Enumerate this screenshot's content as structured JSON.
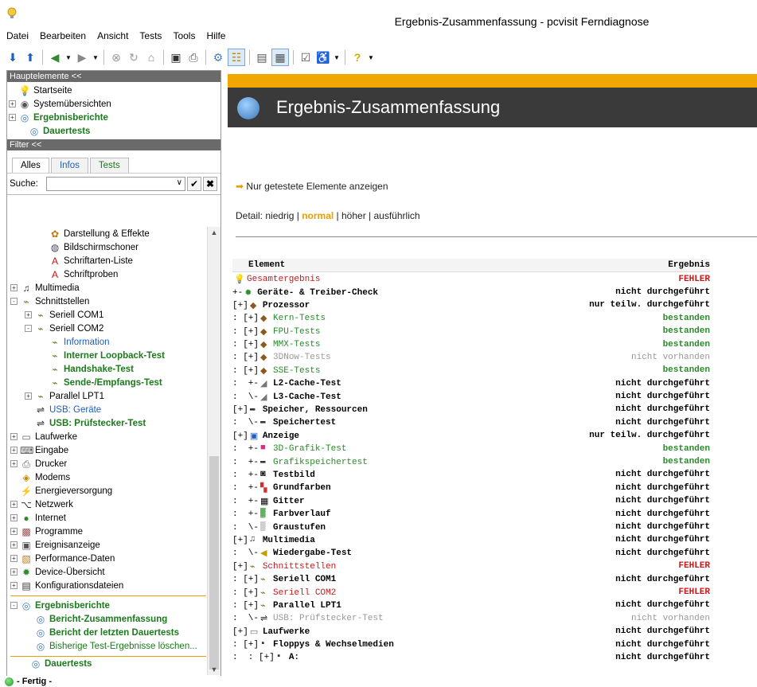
{
  "window": {
    "title": "Ergebnis-Zusammenfassung - pcvisit Ferndiagnose"
  },
  "menu": [
    "Datei",
    "Bearbeiten",
    "Ansicht",
    "Tests",
    "Tools",
    "Hilfe"
  ],
  "toolbar_icons": [
    "arrow-down-icon",
    "arrow-up-icon",
    "back-icon",
    "back-dropdown",
    "forward-icon",
    "forward-dropdown",
    "stop-icon",
    "refresh-icon",
    "home-icon",
    "save-icon",
    "print-icon",
    "gear-icon",
    "tree-view-icon",
    "page-icon",
    "report-icon",
    "properties-icon",
    "accessibility-icon",
    "accessibility-dropdown",
    "help-icon",
    "help-dropdown"
  ],
  "left": {
    "main_header": "Hauptelemente <<",
    "main_items": [
      {
        "label": "Startseite",
        "icon": "bulb-icon",
        "style": "normal"
      },
      {
        "label": "Systemübersichten",
        "icon": "eye-icon",
        "style": "normal",
        "exp": "+"
      },
      {
        "label": "Ergebnisberichte",
        "icon": "report-icon",
        "style": "green-bold",
        "exp": "+"
      },
      {
        "label": "Dauertests",
        "icon": "report-icon",
        "style": "green-bold"
      }
    ],
    "filter_header": "Filter <<",
    "tabs": [
      "Alles",
      "Infos",
      "Tests"
    ],
    "search_label": "Suche:",
    "search_value": "",
    "tree": [
      {
        "label": "Darstellung & Effekte",
        "indent": 2,
        "icon": "display-effects-icon"
      },
      {
        "label": "Bildschirmschoner",
        "indent": 2,
        "icon": "screensaver-icon"
      },
      {
        "label": "Schriftarten-Liste",
        "indent": 2,
        "icon": "font-icon"
      },
      {
        "label": "Schriftproben",
        "indent": 2,
        "icon": "font-icon"
      },
      {
        "label": "Multimedia",
        "indent": 0,
        "icon": "multimedia-icon",
        "exp": "+"
      },
      {
        "label": "Schnittstellen",
        "indent": 0,
        "icon": "plug-icon",
        "exp": "-"
      },
      {
        "label": "Seriell COM1",
        "indent": 1,
        "icon": "plug-icon",
        "exp": "+"
      },
      {
        "label": "Seriell COM2",
        "indent": 1,
        "icon": "plug-icon",
        "exp": "-"
      },
      {
        "label": "Information",
        "indent": 2,
        "icon": "plug-icon",
        "style": "blue"
      },
      {
        "label": "Interner Loopback-Test",
        "indent": 2,
        "icon": "plug-icon",
        "style": "green-bold"
      },
      {
        "label": "Handshake-Test",
        "indent": 2,
        "icon": "plug-icon",
        "style": "green-bold"
      },
      {
        "label": "Sende-/Empfangs-Test",
        "indent": 2,
        "icon": "plug-icon",
        "style": "green-bold"
      },
      {
        "label": "Parallel LPT1",
        "indent": 1,
        "icon": "plug-icon",
        "exp": "+"
      },
      {
        "label": "USB: Geräte",
        "indent": 1,
        "icon": "usb-icon",
        "style": "blue"
      },
      {
        "label": "USB: Prüfstecker-Test",
        "indent": 1,
        "icon": "usb-icon",
        "style": "green-bold"
      },
      {
        "label": "Laufwerke",
        "indent": 0,
        "icon": "drive-icon",
        "exp": "+"
      },
      {
        "label": "Eingabe",
        "indent": 0,
        "icon": "keyboard-icon",
        "exp": "+"
      },
      {
        "label": "Drucker",
        "indent": 0,
        "icon": "printer-icon",
        "exp": "+"
      },
      {
        "label": "Modems",
        "indent": 0,
        "icon": "modem-icon"
      },
      {
        "label": "Energieversorgung",
        "indent": 0,
        "icon": "power-icon"
      },
      {
        "label": "Netzwerk",
        "indent": 0,
        "icon": "network-icon",
        "exp": "+"
      },
      {
        "label": "Internet",
        "indent": 0,
        "icon": "globe-icon",
        "exp": "+"
      },
      {
        "label": "Programme",
        "indent": 0,
        "icon": "programs-icon",
        "exp": "+"
      },
      {
        "label": "Ereignisanzeige",
        "indent": 0,
        "icon": "event-icon",
        "exp": "+"
      },
      {
        "label": "Performance-Daten",
        "indent": 0,
        "icon": "chart-icon",
        "exp": "+"
      },
      {
        "label": "Device-Übersicht",
        "indent": 0,
        "icon": "device-icon",
        "exp": "+"
      },
      {
        "label": "Konfigurationsdateien",
        "indent": 0,
        "icon": "config-icon",
        "exp": "+"
      }
    ],
    "reports_section": [
      {
        "label": "Ergebnisberichte",
        "indent": 0,
        "icon": "report-icon",
        "exp": "-",
        "style": "green-bold"
      },
      {
        "label": "Bericht-Zusammenfassung",
        "indent": 1,
        "icon": "report-icon",
        "style": "green-bold"
      },
      {
        "label": "Bericht der letzten Dauertests",
        "indent": 1,
        "icon": "report-icon",
        "style": "green-bold"
      },
      {
        "label": "Bisherige Test-Ergebnisse löschen...",
        "indent": 1,
        "icon": "report-icon",
        "style": "green"
      }
    ],
    "dauertests": {
      "label": "Dauertests",
      "icon": "report-icon",
      "style": "green-bold"
    }
  },
  "right": {
    "heading": "Ergebnis-Zusammenfassung",
    "only_tested_link": "Nur getestete Elemente anzeigen",
    "detail_label": "Detail:",
    "detail_options": [
      "niedrig",
      "normal",
      "höher",
      "ausführlich"
    ],
    "detail_selected": "normal",
    "table_headers": {
      "element": "Element",
      "result": "Ergebnis"
    },
    "rows": [
      {
        "prefix": "",
        "icon": "bulb-icon",
        "label": "Gesamtergebnis",
        "result": "FEHLER",
        "lc": "red",
        "rc": "red"
      },
      {
        "prefix": "+-",
        "icon": "device-check-icon",
        "label": "Geräte- & Treiber-Check",
        "result": "nicht durchgeführt",
        "lc": "black-bold",
        "rc": "black"
      },
      {
        "prefix": "[+]",
        "icon": "cpu-icon",
        "label": "Prozessor",
        "result": "nur teilw. durchgeführt",
        "lc": "black-bold",
        "rc": "black"
      },
      {
        "prefix": ": [+]",
        "icon": "cpu-icon",
        "label": "Kern-Tests",
        "result": "bestanden",
        "lc": "green",
        "rc": "green"
      },
      {
        "prefix": ": [+]",
        "icon": "cpu-icon",
        "label": "FPU-Tests",
        "result": "bestanden",
        "lc": "green",
        "rc": "green"
      },
      {
        "prefix": ": [+]",
        "icon": "cpu-icon",
        "label": "MMX-Tests",
        "result": "bestanden",
        "lc": "green",
        "rc": "green"
      },
      {
        "prefix": ": [+]",
        "icon": "cpu-icon",
        "label": "3DNow-Tests",
        "result": "nicht vorhanden",
        "lc": "gray",
        "rc": "gray"
      },
      {
        "prefix": ": [+]",
        "icon": "cpu-icon",
        "label": "SSE-Tests",
        "result": "bestanden",
        "lc": "green",
        "rc": "green"
      },
      {
        "prefix": ":  +-",
        "icon": "cache-icon",
        "label": "L2-Cache-Test",
        "result": "nicht durchgeführt",
        "lc": "black-bold",
        "rc": "black"
      },
      {
        "prefix": ":  \\-",
        "icon": "cache-icon",
        "label": "L3-Cache-Test",
        "result": "nicht durchgeführt",
        "lc": "black-bold",
        "rc": "black"
      },
      {
        "prefix": "[+]",
        "icon": "memory-icon",
        "label": "Speicher, Ressourcen",
        "result": "nicht durchgeführt",
        "lc": "black-bold",
        "rc": "black"
      },
      {
        "prefix": ":  \\-",
        "icon": "memory-icon",
        "label": "Speichertest",
        "result": "nicht durchgeführt",
        "lc": "black-bold",
        "rc": "black"
      },
      {
        "prefix": "[+]",
        "icon": "monitor-icon",
        "label": "Anzeige",
        "result": "nur teilw. durchgeführt",
        "lc": "black-bold",
        "rc": "black"
      },
      {
        "prefix": ":  +-",
        "icon": "3d-icon",
        "label": "3D-Grafik-Test",
        "result": "bestanden",
        "lc": "green",
        "rc": "green"
      },
      {
        "prefix": ":  +-",
        "icon": "memory-icon",
        "label": "Grafikspeichertest",
        "result": "bestanden",
        "lc": "green",
        "rc": "green"
      },
      {
        "prefix": ":  +-",
        "icon": "testimage-icon",
        "label": "Testbild",
        "result": "nicht durchgeführt",
        "lc": "black-bold",
        "rc": "black"
      },
      {
        "prefix": ":  +-",
        "icon": "colors-icon",
        "label": "Grundfarben",
        "result": "nicht durchgeführt",
        "lc": "black-bold",
        "rc": "black"
      },
      {
        "prefix": ":  +-",
        "icon": "grid-icon",
        "label": "Gitter",
        "result": "nicht durchgeführt",
        "lc": "black-bold",
        "rc": "black"
      },
      {
        "prefix": ":  +-",
        "icon": "gradient-icon",
        "label": "Farbverlauf",
        "result": "nicht durchgeführt",
        "lc": "black-bold",
        "rc": "black"
      },
      {
        "prefix": ":  \\-",
        "icon": "grayscale-icon",
        "label": "Graustufen",
        "result": "nicht durchgeführt",
        "lc": "black-bold",
        "rc": "black"
      },
      {
        "prefix": "[+]",
        "icon": "multimedia-icon",
        "label": "Multimedia",
        "result": "nicht durchgeführt",
        "lc": "black-bold",
        "rc": "black"
      },
      {
        "prefix": ":  \\-",
        "icon": "speaker-icon",
        "label": "Wiedergabe-Test",
        "result": "nicht durchgeführt",
        "lc": "black-bold",
        "rc": "black"
      },
      {
        "prefix": "[+]",
        "icon": "plug-icon",
        "label": "Schnittstellen",
        "result": "FEHLER",
        "lc": "red",
        "rc": "red"
      },
      {
        "prefix": ": [+]",
        "icon": "plug-icon",
        "label": "Seriell COM1",
        "result": "nicht durchgeführt",
        "lc": "black-bold",
        "rc": "black"
      },
      {
        "prefix": ": [+]",
        "icon": "plug-icon",
        "label": "Seriell COM2",
        "result": "FEHLER",
        "lc": "red",
        "rc": "red"
      },
      {
        "prefix": ": [+]",
        "icon": "plug-icon",
        "label": "Parallel LPT1",
        "result": "nicht durchgeführt",
        "lc": "black-bold",
        "rc": "black"
      },
      {
        "prefix": ":  \\-",
        "icon": "usb-icon",
        "label": "USB: Prüfstecker-Test",
        "result": "nicht vorhanden",
        "lc": "gray",
        "rc": "gray"
      },
      {
        "prefix": "[+]",
        "icon": "drive-icon",
        "label": "Laufwerke",
        "result": "nicht durchgeführt",
        "lc": "black-bold",
        "rc": "black"
      },
      {
        "prefix": ": [+]",
        "icon": "floppy-icon",
        "label": "Floppys & Wechselmedien",
        "result": "nicht durchgeführt",
        "lc": "black-bold",
        "rc": "black"
      },
      {
        "prefix": ":  : [+]",
        "icon": "floppy-icon",
        "label": "A:",
        "result": "nicht durchgeführt",
        "lc": "black-bold",
        "rc": "black"
      }
    ]
  },
  "status": {
    "text": "- Fertig -"
  },
  "colors": {
    "accent": "#f0a800",
    "header_dark": "#3a3a3a",
    "green": "#1b7a1b",
    "red": "#c81a1a"
  }
}
